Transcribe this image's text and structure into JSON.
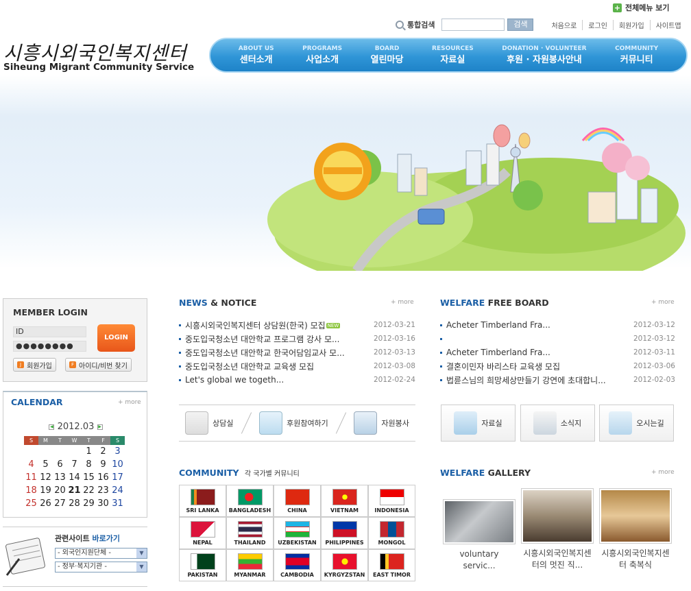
{
  "header": {
    "all_menu": "전체메뉴 보기",
    "search_label": "통합검색",
    "search_value": "",
    "search_button": "검색",
    "links": [
      "처음으로",
      "로그인",
      "회원가입",
      "사이트맵"
    ],
    "logo_kr": "시흥시외국인복지센터",
    "logo_en": "Siheung Migrant Community Service"
  },
  "nav": [
    {
      "en": "ABOUT US",
      "kr": "센터소개"
    },
    {
      "en": "PROGRAMS",
      "kr": "사업소개"
    },
    {
      "en": "BOARD",
      "kr": "열린마당"
    },
    {
      "en": "RESOURCES",
      "kr": "자료실"
    },
    {
      "en": "DONATION · VOLUNTEER",
      "kr": "후원 · 자원봉사안내"
    },
    {
      "en": "COMMUNITY",
      "kr": "커뮤니티"
    }
  ],
  "login": {
    "title": "MEMBER LOGIN",
    "id_value": "ID",
    "pw_value": "●●●●●●●●",
    "login_button": "LOGIN",
    "join_button": "회원가입",
    "find_button": "아이디/비번 찾기"
  },
  "calendar": {
    "title": "CALENDAR",
    "more": "more",
    "month": "2012.03",
    "weekdays": [
      "S",
      "M",
      "T",
      "W",
      "T",
      "F",
      "S"
    ],
    "weeks": [
      [
        "",
        "",
        "",
        "",
        "1",
        "2",
        "3"
      ],
      [
        "4",
        "5",
        "6",
        "7",
        "8",
        "9",
        "10"
      ],
      [
        "11",
        "12",
        "13",
        "14",
        "15",
        "16",
        "17"
      ],
      [
        "18",
        "19",
        "20",
        "21",
        "22",
        "23",
        "24"
      ],
      [
        "25",
        "26",
        "27",
        "28",
        "29",
        "30",
        "31"
      ]
    ]
  },
  "related": {
    "title_a": "관련사이트",
    "title_b": "바로가기",
    "select1": "- 외국인지원단체 -",
    "select2": "- 정부·복지기관 -"
  },
  "news": {
    "title_a": "NEWS",
    "title_b": "& NOTICE",
    "more": "more",
    "new_badge": "NEW",
    "items": [
      {
        "text": "시흥시외국인복지센터 상담원(한국) 모집",
        "date": "2012-03-21"
      },
      {
        "text": "중도입국청소년 대안학교 프로그램 강사 모...",
        "date": "2012-03-16"
      },
      {
        "text": "중도입국청소년 대안학교 한국어담임교사 모...",
        "date": "2012-03-13"
      },
      {
        "text": "중도입국청소년 대안학교 교육생 모집",
        "date": "2012-03-08"
      },
      {
        "text": "Let's global we togeth...",
        "date": "2012-02-24"
      }
    ]
  },
  "board": {
    "title_a": "WELFARE",
    "title_b": "FREE BOARD",
    "more": "more",
    "items": [
      {
        "text": "Acheter Timberland Fra...",
        "date": "2012-03-12"
      },
      {
        "text": "",
        "date": "2012-03-12"
      },
      {
        "text": "Acheter Timberland Fra...",
        "date": "2012-03-11"
      },
      {
        "text": "결혼이민자 바리스타 교육생 모집",
        "date": "2012-03-06"
      },
      {
        "text": "법륜스님의 희망세상만들기 강연에 초대합니...",
        "date": "2012-02-03"
      }
    ]
  },
  "quick_left": [
    "상담실",
    "후원참여하기",
    "자원봉사"
  ],
  "quick_right": [
    "자료실",
    "소식지",
    "오시는길"
  ],
  "community": {
    "title_a": "COMMUNITY",
    "subtitle": "각 국가별 커뮤니티",
    "countries": [
      "SRI LANKA",
      "BANGLADESH",
      "CHINA",
      "VIETNAM",
      "INDONESIA",
      "NEPAL",
      "THAILAND",
      "UZBEKISTAN",
      "PHILIPPINES",
      "MONGOL",
      "PAKISTAN",
      "MYANMAR",
      "CAMBODIA",
      "KYRGYZSTAN",
      "EAST TIMOR"
    ]
  },
  "gallery": {
    "title_a": "WELFARE",
    "title_b": "GALLERY",
    "more": "more",
    "items": [
      {
        "caption": "voluntary servic..."
      },
      {
        "caption": "시흥시외국인복지센터의 멋진 직..."
      },
      {
        "caption": "시흥시외국인복지센터 축복식"
      }
    ]
  },
  "colors": {
    "nav": "#2f95d7",
    "accent": "#1b5fa6",
    "login": "#f07d21"
  }
}
